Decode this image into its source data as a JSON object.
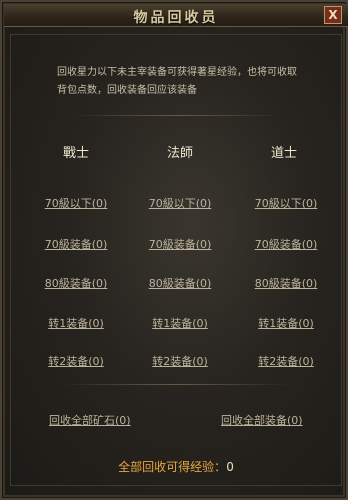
{
  "window": {
    "title": "物品回收员",
    "close_glyph": "X"
  },
  "description": "回收星力以下未主宰装备可获得著星经验，也将可收取背包点数，回收装备回应该装备",
  "columns": [
    {
      "header": "戰士",
      "rows": [
        "70級以下(0)",
        "70級装备(0)",
        "80級装备(0)",
        "转1装备(0)",
        "转2装备(0)"
      ]
    },
    {
      "header": "法師",
      "rows": [
        "70級以下(0)",
        "70級装备(0)",
        "80級装备(0)",
        "转1装备(0)",
        "转2装备(0)"
      ]
    },
    {
      "header": "道士",
      "rows": [
        "70級以下(0)",
        "70級装备(0)",
        "80級装备(0)",
        "转1装备(0)",
        "转2装备(0)"
      ]
    }
  ],
  "actions": {
    "recycle_all_ore": "回收全部矿石(0)",
    "recycle_all_equipment": "回收全部装备(0)"
  },
  "total": {
    "label": "全部回收可得经验：",
    "value": "0"
  }
}
